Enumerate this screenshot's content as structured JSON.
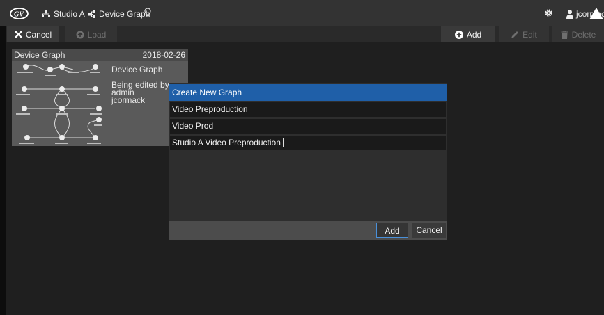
{
  "header": {
    "breadcrumbs": [
      {
        "label": "Studio A",
        "icon": "sitemap-icon"
      },
      {
        "label": "Device Graph",
        "icon": "graph-icon"
      }
    ],
    "username": "jcormack"
  },
  "toolbar": {
    "cancel_label": "Cancel",
    "load_label": "Load",
    "add_label": "Add",
    "edit_label": "Edit",
    "delete_label": "Delete"
  },
  "card": {
    "title": "Device Graph",
    "date": "2018-02-26",
    "name": "Device Graph",
    "editing_label": "Being edited by:",
    "editors": [
      "admin",
      "jcormack"
    ]
  },
  "dialog": {
    "title": "Create New Graph",
    "items": [
      "Video Preproduction",
      "Video Prod",
      "Studio A Video Preproduction"
    ],
    "add_label": "Add",
    "cancel_label": "Cancel"
  },
  "colors": {
    "accent": "#1f5fa8",
    "focus_border": "#4a90d9",
    "background": "#1c1c1c"
  }
}
